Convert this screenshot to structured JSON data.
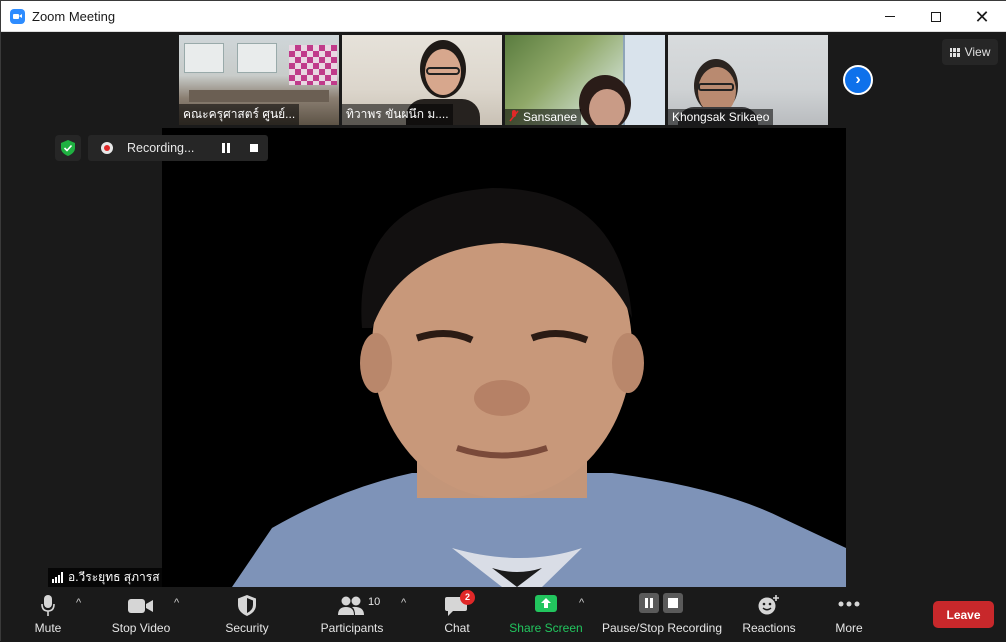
{
  "window": {
    "title": "Zoom Meeting"
  },
  "thumbnails": [
    {
      "name": "คณะครุศาสตร์ ศูนย์..."
    },
    {
      "name": "ทิวาพร ขันผนึก ม...."
    },
    {
      "name": "Sansanee",
      "muted": true
    },
    {
      "name": "Khongsak Srikaeo"
    }
  ],
  "view_button": {
    "label": "View"
  },
  "recording": {
    "label": "Recording..."
  },
  "main_speaker": {
    "name": "อ.วีระยุทธ สุภารส"
  },
  "toolbar": {
    "mute_label": "Mute",
    "stop_video_label": "Stop Video",
    "security_label": "Security",
    "participants_label": "Participants",
    "participants_count": "10",
    "chat_label": "Chat",
    "chat_unread": "2",
    "share_screen_label": "Share Screen",
    "recording_label": "Pause/Stop Recording",
    "reactions_label": "Reactions",
    "more_label": "More",
    "leave_label": "Leave"
  },
  "colors": {
    "accent_blue": "#0e71eb",
    "share_green": "#22c55e",
    "leave_red": "#c8282b",
    "security_green": "#1fb141"
  }
}
